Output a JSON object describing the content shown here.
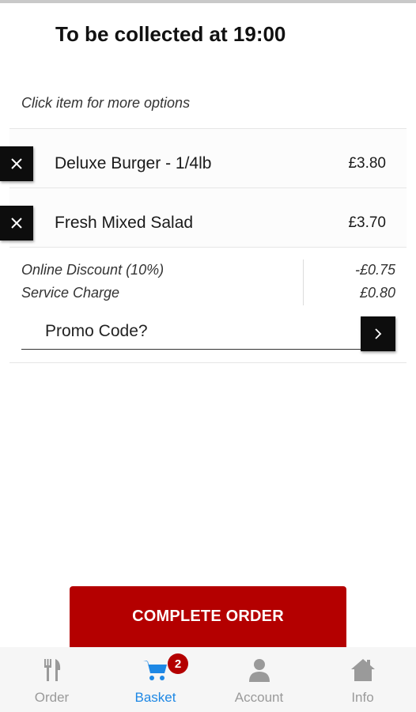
{
  "header": {
    "collection_text": "To be collected at 19:00"
  },
  "basket": {
    "hint": "Click item for more options",
    "items": [
      {
        "name": "Deluxe Burger - 1/4lb",
        "price": "£3.80"
      },
      {
        "name": "Fresh Mixed Salad",
        "price": "£3.70"
      }
    ]
  },
  "summary": {
    "discount_label": "Online Discount (10%)",
    "discount_value": "-£0.75",
    "service_label": "Service Charge",
    "service_value": "£0.80"
  },
  "promo": {
    "placeholder": "Promo Code?"
  },
  "actions": {
    "complete_label": "COMPLETE ORDER"
  },
  "tabbar": {
    "tabs": [
      {
        "label": "Order",
        "icon": "fork-knife-icon"
      },
      {
        "label": "Basket",
        "icon": "cart-icon",
        "active": true,
        "badge": "2"
      },
      {
        "label": "Account",
        "icon": "person-icon"
      },
      {
        "label": "Info",
        "icon": "home-icon"
      }
    ]
  },
  "colors": {
    "accent_red": "#b40000",
    "active_blue": "#1e88e5",
    "inactive_gray": "#9a9a9a",
    "button_black": "#0d0d0d"
  }
}
